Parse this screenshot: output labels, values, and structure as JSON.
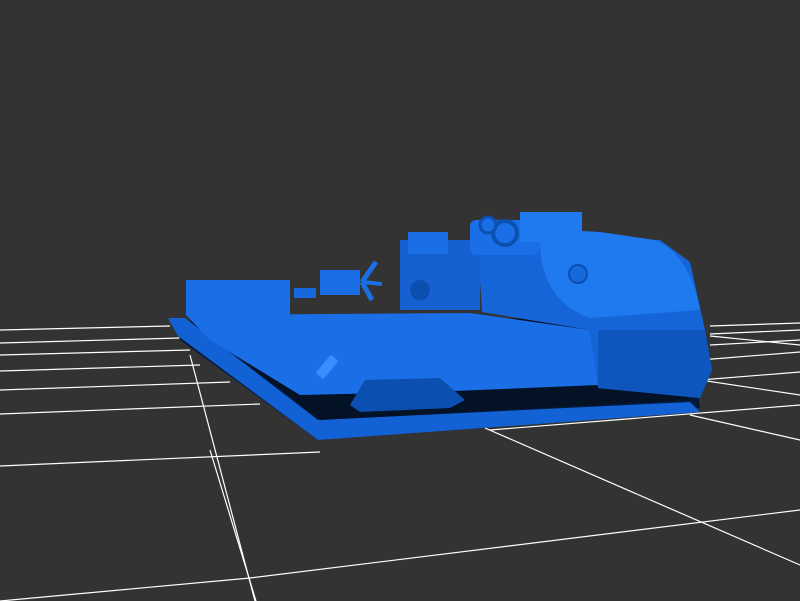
{
  "scene": {
    "background": "#333333",
    "grid_color": "#ffffff",
    "model_color": "#1a6fe6",
    "model_dark": "#0b4fb0",
    "model_shadow": "#062a63"
  }
}
